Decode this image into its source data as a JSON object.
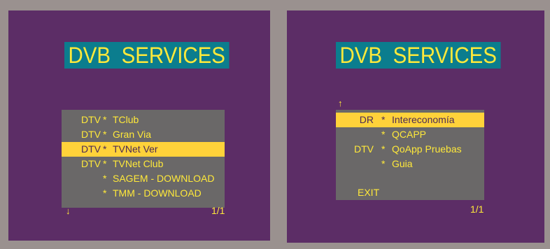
{
  "left_screen": {
    "title": "DVB SERVICES",
    "rows": [
      {
        "tag": "DTV",
        "star": "*",
        "name": "TClub",
        "selected": false
      },
      {
        "tag": "DTV",
        "star": "*",
        "name": "Gran Via",
        "selected": false
      },
      {
        "tag": "DTV",
        "star": "*",
        "name": "TVNet Ver",
        "selected": true
      },
      {
        "tag": "DTV",
        "star": "*",
        "name": "TVNet Club",
        "selected": false
      },
      {
        "tag": "",
        "star": "*",
        "name": "SAGEM - DOWNLOAD",
        "selected": false
      },
      {
        "tag": "",
        "star": "*",
        "name": "TMM - DOWNLOAD",
        "selected": false
      }
    ],
    "scroll_arrow": "↓",
    "scroll_icon": "arrow-down-icon",
    "page_indicator": "1/1"
  },
  "right_screen": {
    "title": "DVB SERVICES",
    "rows": [
      {
        "tag": "DR",
        "star": "*",
        "name": "Intereconomía",
        "selected": true
      },
      {
        "tag": "",
        "star": "*",
        "name": "QCAPP",
        "selected": false
      },
      {
        "tag": "DTV",
        "star": "*",
        "name": "QoApp Pruebas",
        "selected": false
      },
      {
        "tag": "",
        "star": "*",
        "name": "Guia",
        "selected": false
      }
    ],
    "exit_label": "EXIT",
    "scroll_arrow": "↑",
    "scroll_icon": "arrow-up-icon",
    "page_indicator": "1/1"
  },
  "colors": {
    "screen_background": "#5c2d66",
    "title_background": "#0b7d8e",
    "text": "#ffe93a",
    "panel": "#6a6868",
    "highlight": "#ffd23a",
    "bezel": "#9a918f"
  }
}
